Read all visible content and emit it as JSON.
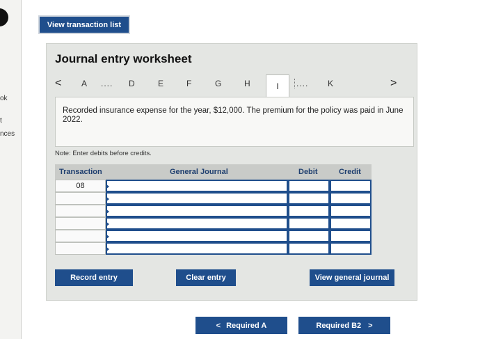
{
  "left_panel": {
    "items": [
      "ok",
      "t",
      "nces"
    ]
  },
  "header": {
    "view_list_label": "View transaction list"
  },
  "worksheet": {
    "title": "Journal entry worksheet",
    "tabs": [
      "A",
      "....",
      "D",
      "E",
      "F",
      "G",
      "H",
      "I",
      "....",
      "K"
    ],
    "active_tab": "I",
    "prev_arrow": "<",
    "next_arrow": ">",
    "description": "Recorded insurance expense for the year, $12,000. The premium for the policy was paid in June 2022.",
    "note": "Note: Enter debits before credits.",
    "table": {
      "headers": {
        "transaction": "Transaction",
        "general_journal": "General Journal",
        "debit": "Debit",
        "credit": "Credit"
      },
      "rows": [
        {
          "transaction": "08",
          "account": "",
          "debit": "",
          "credit": ""
        },
        {
          "transaction": "",
          "account": "",
          "debit": "",
          "credit": ""
        },
        {
          "transaction": "",
          "account": "",
          "debit": "",
          "credit": ""
        },
        {
          "transaction": "",
          "account": "",
          "debit": "",
          "credit": ""
        },
        {
          "transaction": "",
          "account": "",
          "debit": "",
          "credit": ""
        },
        {
          "transaction": "",
          "account": "",
          "debit": "",
          "credit": ""
        }
      ]
    },
    "buttons": {
      "record": "Record entry",
      "clear": "Clear entry",
      "view_general_journal": "View general journal"
    }
  },
  "navigation": {
    "prev_label": "Required A",
    "next_label": "Required B2"
  },
  "colors": {
    "accent": "#1f4e8c",
    "panel": "#e4e6e3"
  }
}
